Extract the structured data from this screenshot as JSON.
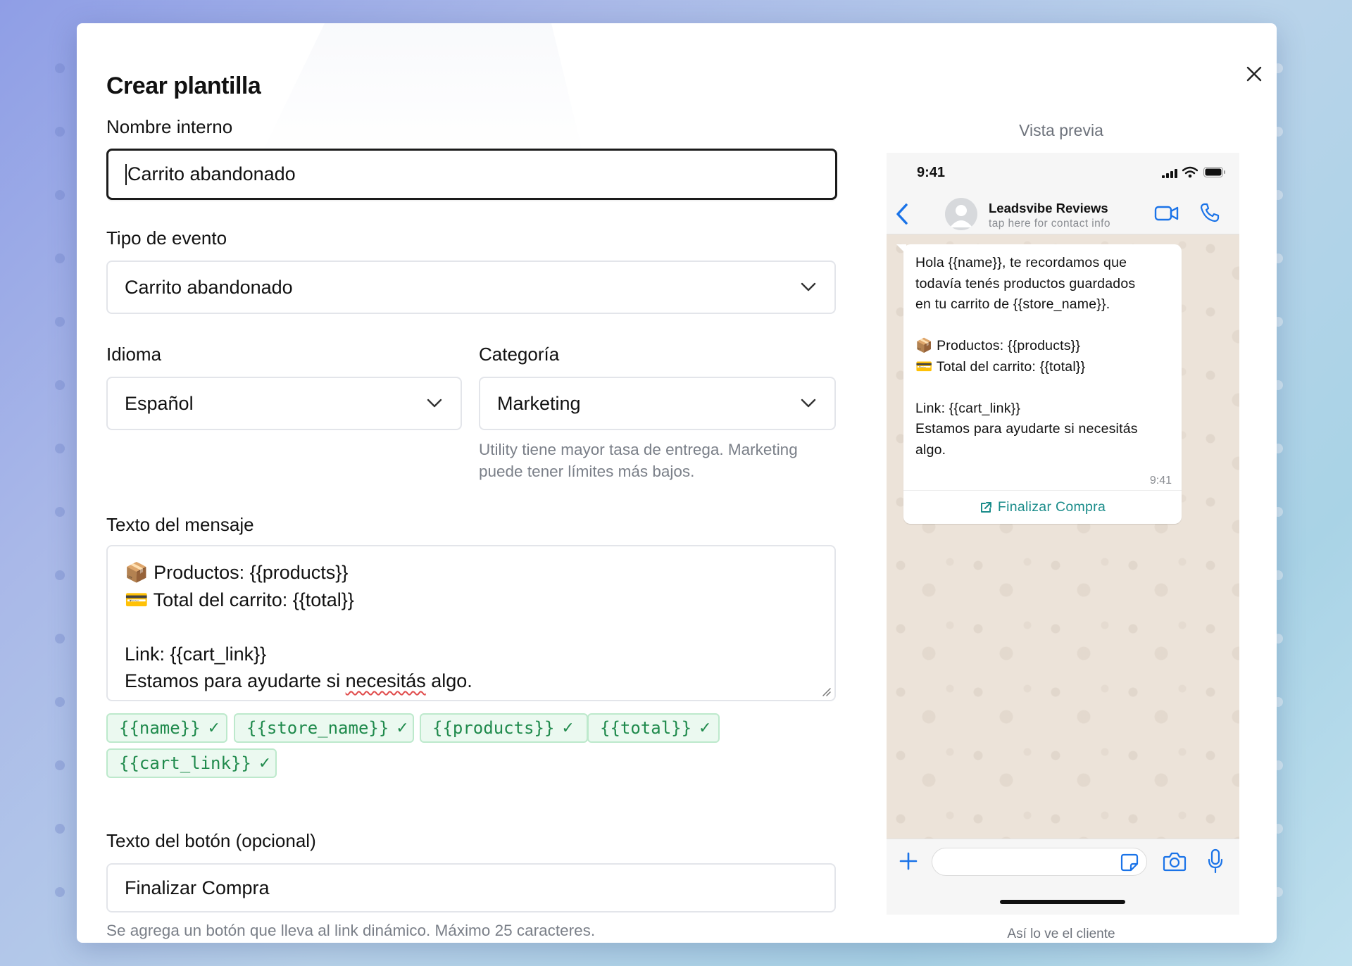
{
  "modal": {
    "title": "Crear plantilla"
  },
  "form": {
    "internal_name": {
      "label": "Nombre interno",
      "value": "Carrito abandonado"
    },
    "event_type": {
      "label": "Tipo de evento",
      "value": "Carrito abandonado"
    },
    "language": {
      "label": "Idioma",
      "value": "Español"
    },
    "category": {
      "label": "Categoría",
      "value": "Marketing",
      "help_line1": "Utility tiene mayor tasa de entrega. Marketing",
      "help_line2": "puede tener límites más bajos."
    },
    "message": {
      "label": "Texto del mensaje",
      "lines": {
        "l1": "📦 Productos: {{products}}",
        "l2": "💳 Total del carrito: {{total}}",
        "l3": "",
        "l4": "Link: {{cart_link}}",
        "l5_a": "Estamos para ayudarte si ",
        "l5_b": "necesitás",
        "l5_c": " algo."
      }
    },
    "variables": {
      "t1": "{{name}}",
      "t2": "{{store_name}}",
      "t3": "{{products}}",
      "t4": "{{total}}",
      "t5": "{{cart_link}}",
      "check": "✓"
    },
    "button_text": {
      "label": "Texto del botón (opcional)",
      "value": "Finalizar Compra",
      "help": "Se agrega un botón que lleva al link dinámico. Máximo 25 caracteres."
    }
  },
  "preview": {
    "title": "Vista previa",
    "footer": "Así lo ve el cliente",
    "status_time": "9:41",
    "contact_name": "Leadsvibe Reviews",
    "contact_sub": "tap here for contact info",
    "bubble": {
      "b1": "Hola {{name}}, te recordamos que",
      "b2": "todavía tenés productos guardados",
      "b3": "en tu carrito de {{store_name}}.",
      "b4": "",
      "b5": "📦 Productos: {{products}}",
      "b6": "💳 Total del carrito: {{total}}",
      "b7": "",
      "b8": "Link: {{cart_link}}",
      "b9": "Estamos para ayudarte si necesitás",
      "b10": "algo.",
      "time": "9:41",
      "button": "Finalizar Compra"
    }
  },
  "colors": {
    "accent_green": "#1f8a4c",
    "whatsapp_blue": "#1a73e8",
    "preview_button": "#1a8c8a"
  },
  "icons": {
    "close": "close-icon",
    "chevron": "chevron-down-icon",
    "back": "back-arrow-icon",
    "video": "video-call-icon",
    "phone": "phone-icon",
    "plus": "plus-icon",
    "sticker": "sticker-icon",
    "camera": "camera-icon",
    "mic": "microphone-icon",
    "external": "external-link-icon"
  }
}
